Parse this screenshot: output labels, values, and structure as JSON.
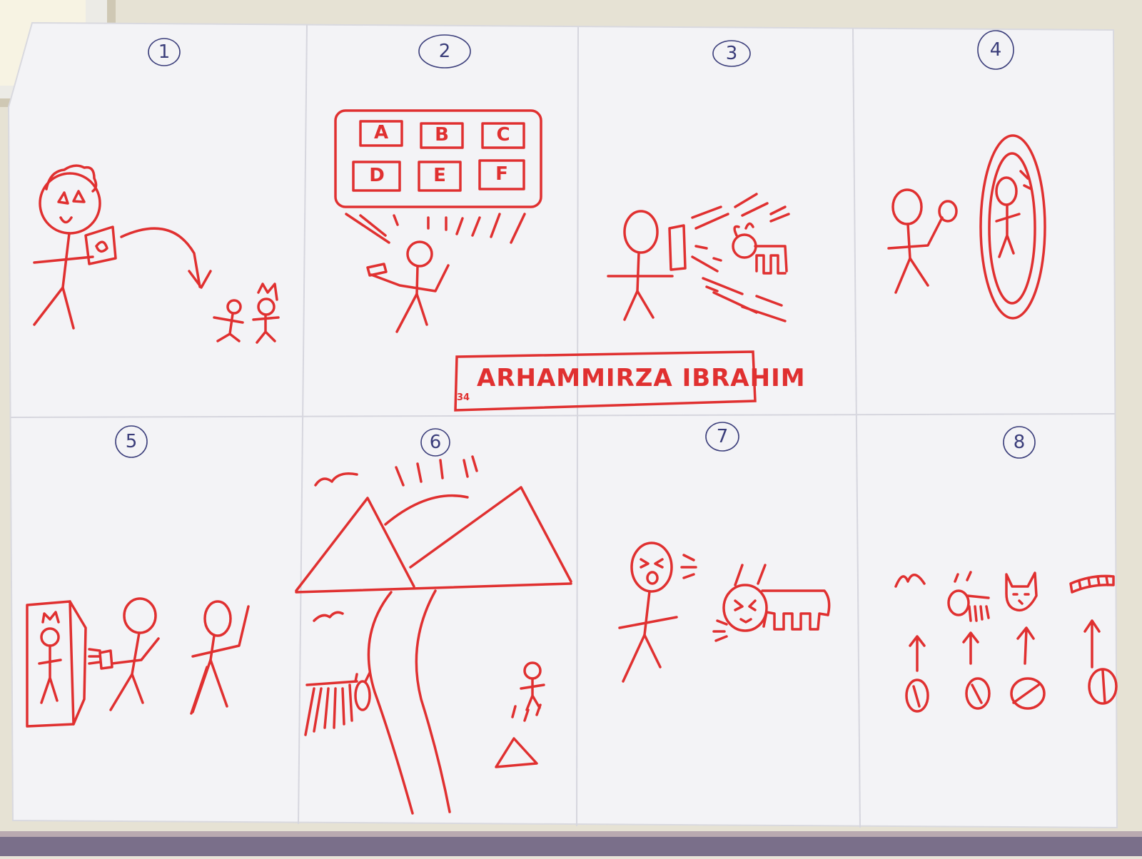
{
  "panels": [
    {
      "number": "1"
    },
    {
      "number": "2"
    },
    {
      "number": "3"
    },
    {
      "number": "4"
    },
    {
      "number": "5"
    },
    {
      "number": "6"
    },
    {
      "number": "7"
    },
    {
      "number": "8"
    }
  ],
  "menu_grid": {
    "letters": [
      "A",
      "B",
      "C",
      "D",
      "E",
      "F"
    ]
  },
  "name_box": {
    "text": "ARHAMMIRZA IBRAHIM",
    "small_text": "34"
  },
  "colors": {
    "ink": "#e03030",
    "pen": "#3a3d7a",
    "paper": "#f3f3f6"
  }
}
